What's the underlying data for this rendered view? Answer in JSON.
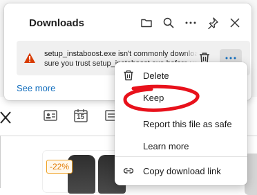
{
  "downloads": {
    "title": "Downloads",
    "header_icons": [
      "folder-icon",
      "search-icon",
      "more-horizontal-icon",
      "pin-icon",
      "close-icon"
    ],
    "item": {
      "line1": "setup_instaboost.exe isn't commonly downloaded. Make",
      "line2": "sure you trust setup_instaboost.exe before you open it.",
      "status_icon": "warning-icon",
      "status_color": "#d83b01"
    },
    "see_more": "See more",
    "accent_color": "#0f6cbd"
  },
  "context_menu": {
    "items": [
      {
        "label": "Delete",
        "icon": "trash-icon"
      },
      {
        "label": "Keep",
        "icon": "none"
      },
      {
        "label": "Report this file as safe",
        "icon": "none"
      },
      {
        "label": "Learn more",
        "icon": "none"
      },
      {
        "label": "Copy download link",
        "icon": "link-icon"
      }
    ],
    "annotation_color": "#e8111b"
  },
  "background_page": {
    "calendar_day": "15",
    "discount_badge": "-22%",
    "partial_text": "ti",
    "accent_color": "#c8107a"
  }
}
